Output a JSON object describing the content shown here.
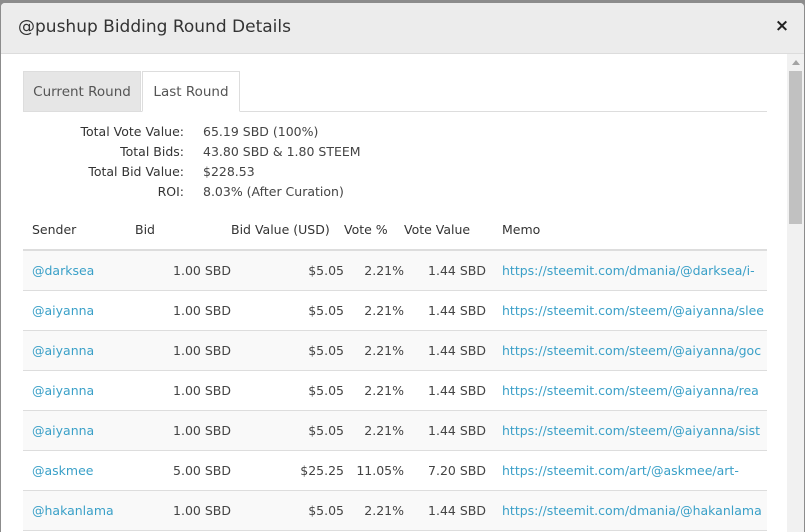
{
  "modal": {
    "title": "@pushup Bidding Round Details",
    "close_label": "×"
  },
  "tabs": [
    {
      "label": "Current Round"
    },
    {
      "label": "Last Round"
    }
  ],
  "summary": [
    {
      "label": "Total Vote Value:",
      "value": "65.19 SBD (100%)"
    },
    {
      "label": "Total Bids:",
      "value": "43.80 SBD & 1.80 STEEM"
    },
    {
      "label": "Total Bid Value:",
      "value": "$228.53"
    },
    {
      "label": "ROI:",
      "value": "8.03% (After Curation)"
    }
  ],
  "table": {
    "headers": [
      "Sender",
      "Bid",
      "Bid Value (USD)",
      "Vote %",
      "Vote Value",
      "Memo"
    ],
    "rows": [
      [
        "@darksea",
        "1.00 SBD",
        "$5.05",
        "2.21%",
        "1.44 SBD",
        "https://steemit.com/dmania/@darksea/i-"
      ],
      [
        "@aiyanna",
        "1.00 SBD",
        "$5.05",
        "2.21%",
        "1.44 SBD",
        "https://steemit.com/steem/@aiyanna/slee"
      ],
      [
        "@aiyanna",
        "1.00 SBD",
        "$5.05",
        "2.21%",
        "1.44 SBD",
        "https://steemit.com/steem/@aiyanna/goc"
      ],
      [
        "@aiyanna",
        "1.00 SBD",
        "$5.05",
        "2.21%",
        "1.44 SBD",
        "https://steemit.com/steem/@aiyanna/rea"
      ],
      [
        "@aiyanna",
        "1.00 SBD",
        "$5.05",
        "2.21%",
        "1.44 SBD",
        "https://steemit.com/steem/@aiyanna/sist"
      ],
      [
        "@askmee",
        "5.00 SBD",
        "$25.25",
        "11.05%",
        "7.20 SBD",
        "https://steemit.com/art/@askmee/art-"
      ],
      [
        "@hakanlama",
        "1.00 SBD",
        "$5.05",
        "2.21%",
        "1.44 SBD",
        "https://steemit.com/dmania/@hakanlama"
      ]
    ]
  },
  "colors": {
    "link": "#3aa0c8",
    "header_bg": "#ececec",
    "stripe": "#f9f9f9"
  }
}
